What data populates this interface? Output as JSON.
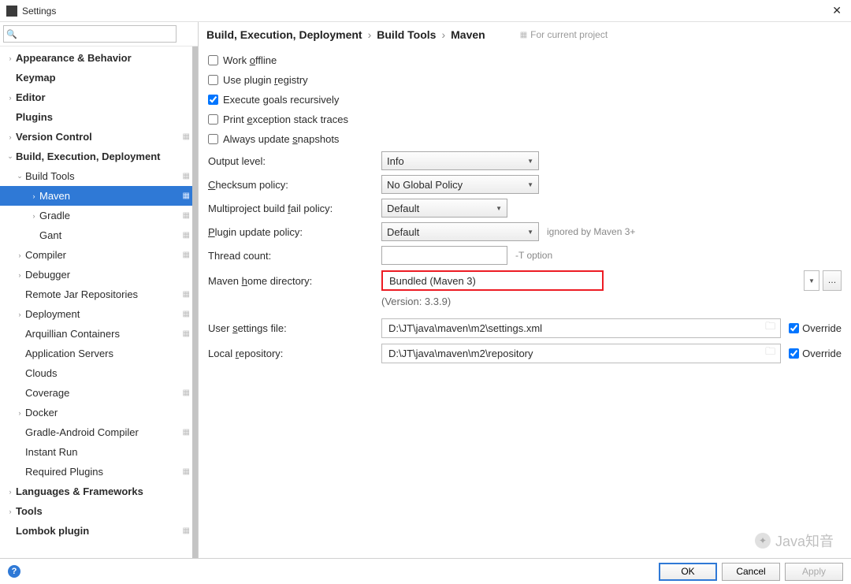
{
  "window": {
    "title": "Settings",
    "close": "✕"
  },
  "search": {
    "placeholder": ""
  },
  "tree": [
    {
      "label": "Appearance & Behavior",
      "bold": true,
      "exp": "›",
      "lvl": 0,
      "proj": false
    },
    {
      "label": "Keymap",
      "bold": true,
      "exp": "",
      "lvl": 0,
      "proj": false
    },
    {
      "label": "Editor",
      "bold": true,
      "exp": "›",
      "lvl": 0,
      "proj": false
    },
    {
      "label": "Plugins",
      "bold": true,
      "exp": "",
      "lvl": 0,
      "proj": false
    },
    {
      "label": "Version Control",
      "bold": true,
      "exp": "›",
      "lvl": 0,
      "proj": true
    },
    {
      "label": "Build, Execution, Deployment",
      "bold": true,
      "exp": "⌄",
      "lvl": 0,
      "proj": false
    },
    {
      "label": "Build Tools",
      "bold": false,
      "exp": "⌄",
      "lvl": 1,
      "proj": true
    },
    {
      "label": "Maven",
      "bold": false,
      "exp": "›",
      "lvl": 2,
      "proj": true,
      "selected": true
    },
    {
      "label": "Gradle",
      "bold": false,
      "exp": "›",
      "lvl": 2,
      "proj": true
    },
    {
      "label": "Gant",
      "bold": false,
      "exp": "",
      "lvl": 2,
      "proj": true
    },
    {
      "label": "Compiler",
      "bold": false,
      "exp": "›",
      "lvl": 1,
      "proj": true
    },
    {
      "label": "Debugger",
      "bold": false,
      "exp": "›",
      "lvl": 1,
      "proj": false
    },
    {
      "label": "Remote Jar Repositories",
      "bold": false,
      "exp": "",
      "lvl": 1,
      "proj": true
    },
    {
      "label": "Deployment",
      "bold": false,
      "exp": "›",
      "lvl": 1,
      "proj": true
    },
    {
      "label": "Arquillian Containers",
      "bold": false,
      "exp": "",
      "lvl": 1,
      "proj": true
    },
    {
      "label": "Application Servers",
      "bold": false,
      "exp": "",
      "lvl": 1,
      "proj": false
    },
    {
      "label": "Clouds",
      "bold": false,
      "exp": "",
      "lvl": 1,
      "proj": false
    },
    {
      "label": "Coverage",
      "bold": false,
      "exp": "",
      "lvl": 1,
      "proj": true
    },
    {
      "label": "Docker",
      "bold": false,
      "exp": "›",
      "lvl": 1,
      "proj": false
    },
    {
      "label": "Gradle-Android Compiler",
      "bold": false,
      "exp": "",
      "lvl": 1,
      "proj": true
    },
    {
      "label": "Instant Run",
      "bold": false,
      "exp": "",
      "lvl": 1,
      "proj": false
    },
    {
      "label": "Required Plugins",
      "bold": false,
      "exp": "",
      "lvl": 1,
      "proj": true
    },
    {
      "label": "Languages & Frameworks",
      "bold": true,
      "exp": "›",
      "lvl": 0,
      "proj": false
    },
    {
      "label": "Tools",
      "bold": true,
      "exp": "›",
      "lvl": 0,
      "proj": false
    },
    {
      "label": "Lombok plugin",
      "bold": true,
      "exp": "",
      "lvl": 0,
      "proj": true
    }
  ],
  "breadcrumb": {
    "a": "Build, Execution, Deployment",
    "b": "Build Tools",
    "c": "Maven",
    "hint": "For current project"
  },
  "checks": {
    "workOffline": {
      "label": "Work offline",
      "u": "o",
      "checked": false
    },
    "usePlugin": {
      "label": "Use plugin registry",
      "u": "r",
      "checked": false
    },
    "executeGoals": {
      "label": "Execute goals recursively",
      "u": "",
      "checked": true
    },
    "printExc": {
      "label": "Print exception stack traces",
      "u": "e",
      "checked": false
    },
    "alwaysUpd": {
      "label": "Always update snapshots",
      "u": "s",
      "checked": false
    }
  },
  "fields": {
    "outputLevel": {
      "label": "Output level:",
      "value": "Info"
    },
    "checksum": {
      "label": "Checksum policy:",
      "u": "C",
      "value": "No Global Policy"
    },
    "multiproject": {
      "label": "Multiproject build fail policy:",
      "u": "f",
      "value": "Default"
    },
    "pluginUpdate": {
      "label": "Plugin update policy:",
      "u": "P",
      "value": "Default",
      "hint": "ignored by Maven 3+"
    },
    "threadCount": {
      "label": "Thread count:",
      "value": "",
      "hint": "-T option"
    },
    "mavenHome": {
      "label": "Maven home directory:",
      "u": "h",
      "value": "Bundled (Maven 3)",
      "version": "(Version: 3.3.9)"
    },
    "userSettings": {
      "label": "User settings file:",
      "u": "s",
      "value": "D:\\JT\\java\\maven\\m2\\settings.xml",
      "override": "Override",
      "overrideChecked": true
    },
    "localRepo": {
      "label": "Local repository:",
      "u": "r",
      "value": "D:\\JT\\java\\maven\\m2\\repository",
      "override": "Override",
      "overrideChecked": true
    }
  },
  "buttons": {
    "ok": "OK",
    "cancel": "Cancel",
    "apply": "Apply",
    "help": "?"
  },
  "watermark": "Java知音"
}
